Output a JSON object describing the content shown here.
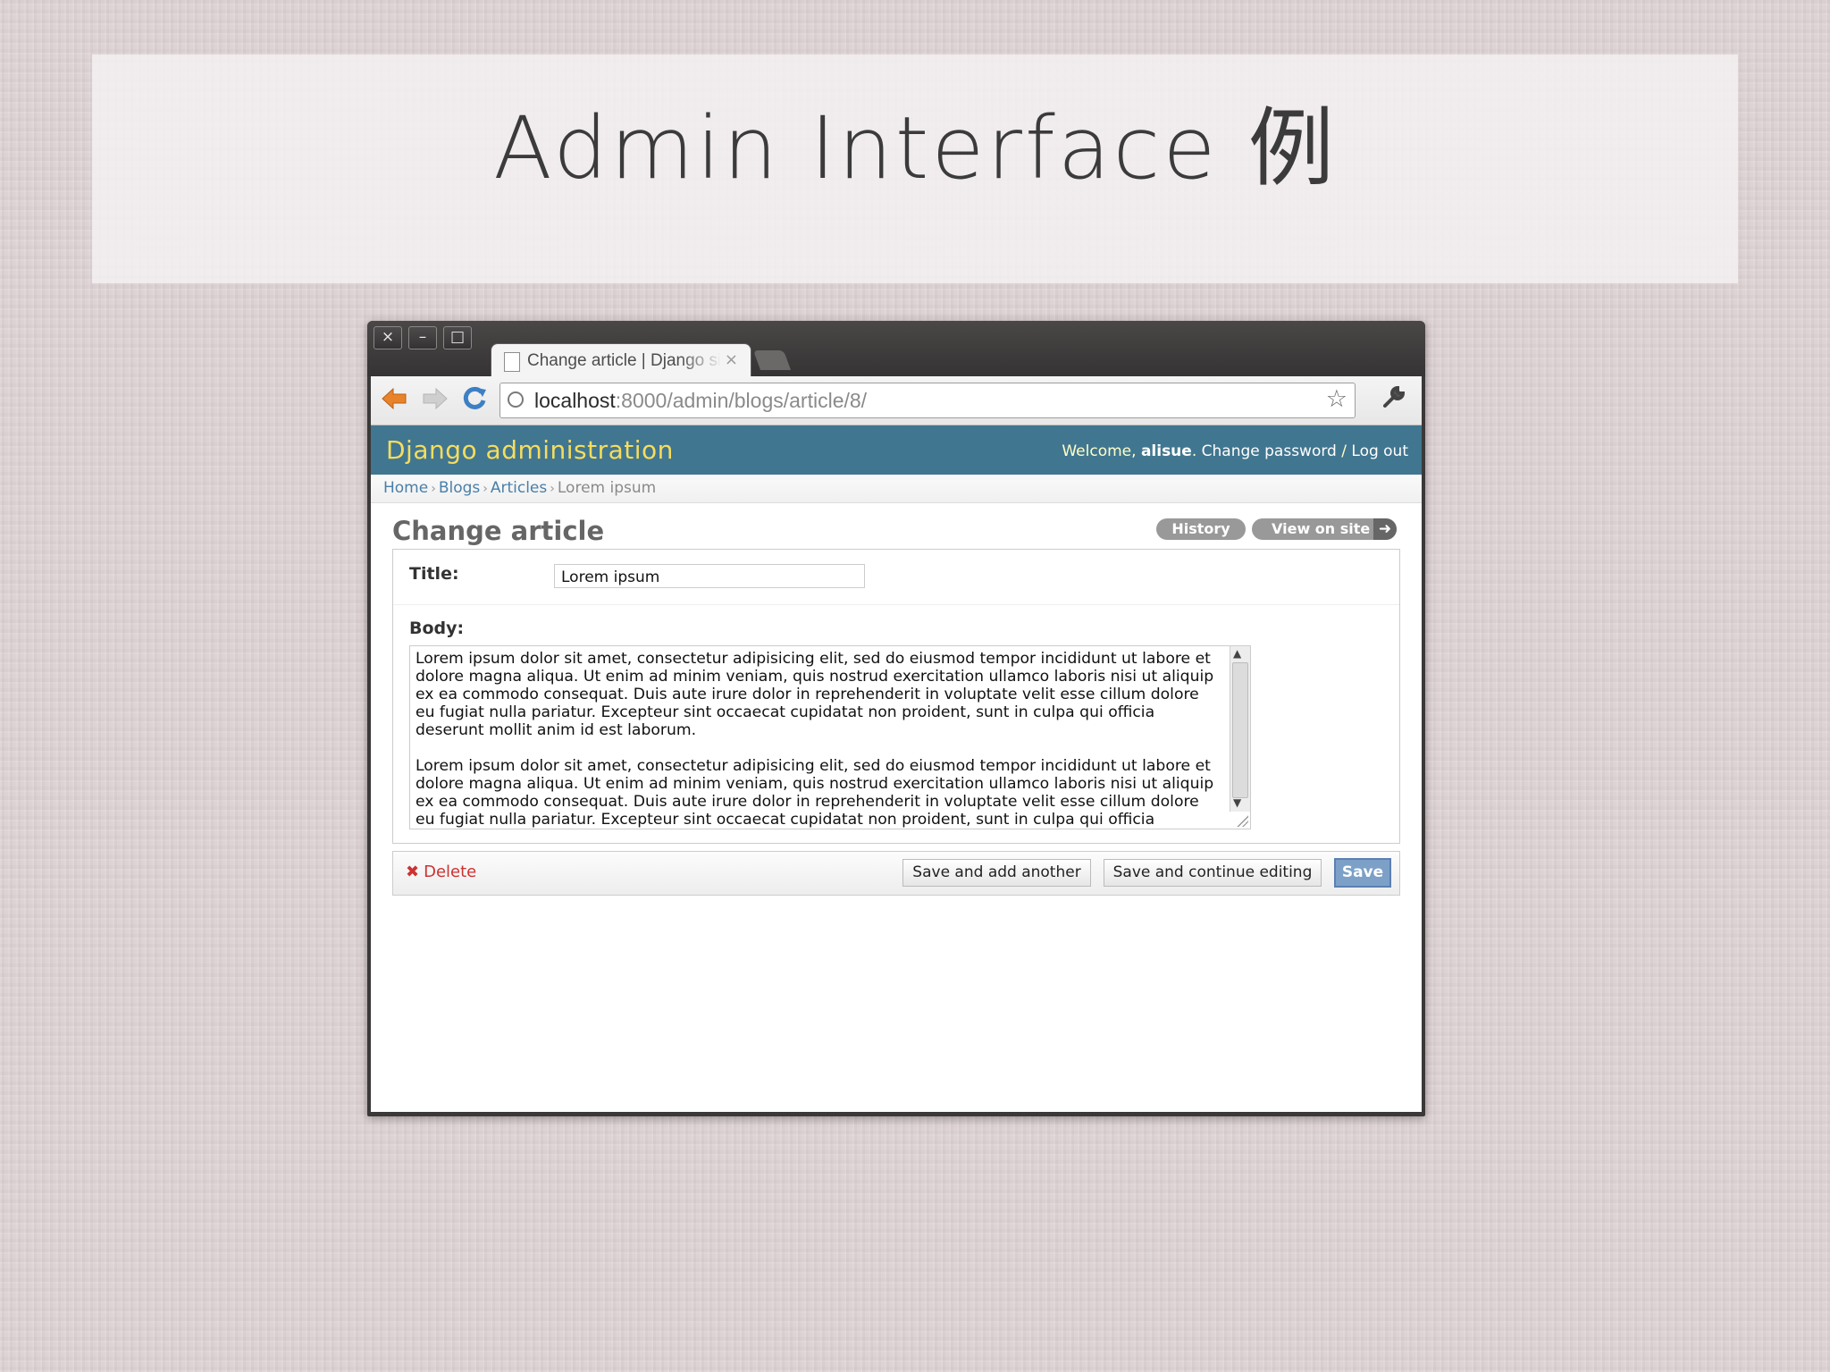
{
  "slide": {
    "title": "Admin Interface 例"
  },
  "browser": {
    "tab_title": "Change article | Django site admin",
    "tab_close": "×",
    "url_host": "localhost",
    "url_path": ":8000/admin/blogs/article/8/",
    "window_controls": [
      "×",
      "–",
      "□"
    ]
  },
  "admin": {
    "site_name": "Django administration",
    "welcome_prefix": "Welcome, ",
    "username": "alisue",
    "welcome_suffix": ". ",
    "change_password": "Change password",
    "separator": " / ",
    "log_out": "Log out"
  },
  "breadcrumbs": {
    "home": "Home",
    "blogs": "Blogs",
    "articles": "Articles",
    "current": "Lorem ipsum",
    "sep": "›"
  },
  "page": {
    "heading": "Change article",
    "history_button": "History",
    "view_on_site_button": "View on site"
  },
  "form": {
    "title_label": "Title:",
    "title_value": "Lorem ipsum",
    "body_label": "Body:",
    "body_value": "Lorem ipsum dolor sit amet, consectetur adipisicing elit, sed do eiusmod tempor incididunt ut labore et\ndolore magna aliqua. Ut enim ad minim veniam, quis nostrud exercitation ullamco laboris nisi ut aliquip\nex ea commodo consequat. Duis aute irure dolor in reprehenderit in voluptate velit esse cillum dolore\neu fugiat nulla pariatur. Excepteur sint occaecat cupidatat non proident, sunt in culpa qui officia\ndeserunt mollit anim id est laborum.\n\nLorem ipsum dolor sit amet, consectetur adipisicing elit, sed do eiusmod tempor incididunt ut labore et\ndolore magna aliqua. Ut enim ad minim veniam, quis nostrud exercitation ullamco laboris nisi ut aliquip\nex ea commodo consequat. Duis aute irure dolor in reprehenderit in voluptate velit esse cillum dolore\neu fugiat nulla pariatur. Excepteur sint occaecat cupidatat non proident, sunt in culpa qui officia"
  },
  "actions": {
    "delete": "Delete",
    "save_add_another": "Save and add another",
    "save_continue": "Save and continue editing",
    "save": "Save"
  },
  "icons": {
    "back": "back-arrow-icon",
    "forward": "forward-arrow-icon",
    "reload": "reload-icon",
    "bookmark": "star-icon",
    "settings": "wrench-icon",
    "delete": "delete-x-icon",
    "view_on_site": "arrow-right-icon"
  },
  "colors": {
    "admin_header": "#417690",
    "site_name": "#f5dd5d",
    "delete": "#cc3333",
    "save_button": "#7ca0c7"
  }
}
